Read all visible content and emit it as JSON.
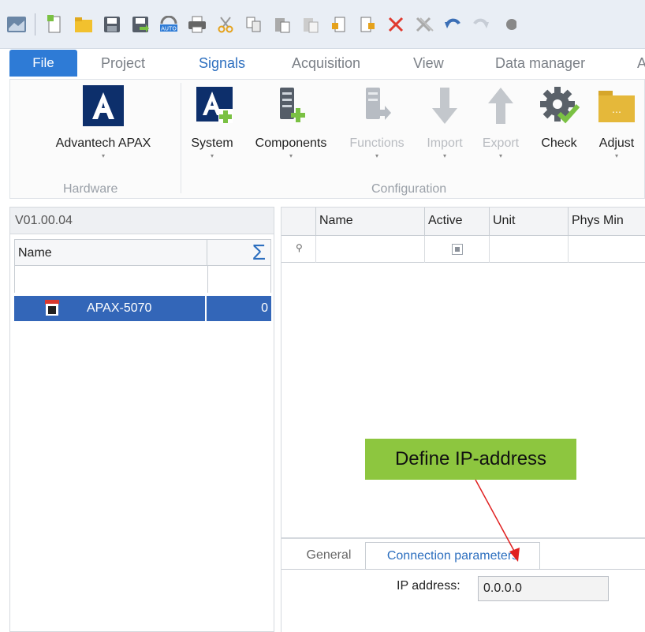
{
  "quick_access": {
    "icons": [
      "app-menu-icon",
      "new-icon",
      "open-icon",
      "save-icon",
      "save-as-icon",
      "auto-icon",
      "print-icon",
      "cut-icon",
      "copy-icon",
      "paste-icon",
      "paste-special-icon",
      "import-file-icon",
      "export-file-icon",
      "delete-icon",
      "delete-all-icon",
      "undo-icon",
      "redo-icon"
    ],
    "auto_label": "AUTO"
  },
  "ribbon_tabs": [
    "File",
    "Project",
    "Signals",
    "Acquisition",
    "View",
    "Data manager",
    "A"
  ],
  "ribbon": {
    "hardware_group": {
      "label": "Hardware",
      "buttons": [
        {
          "label": "Advantech APAX"
        }
      ]
    },
    "configuration_group": {
      "label": "Configuration",
      "buttons": [
        {
          "label": "System",
          "enabled": true
        },
        {
          "label": "Components",
          "enabled": true
        },
        {
          "label": "Functions",
          "enabled": false
        },
        {
          "label": "Import",
          "enabled": false
        },
        {
          "label": "Export",
          "enabled": false
        },
        {
          "label": "Check",
          "enabled": true
        },
        {
          "label": "Adjust",
          "enabled": true
        }
      ]
    }
  },
  "left_panel": {
    "version": "V01.00.04",
    "columns": [
      "Name",
      "Σ"
    ],
    "rows": [
      {
        "name": "APAX-5070",
        "count": "0"
      }
    ]
  },
  "signal_grid": {
    "columns": [
      "Name",
      "Active",
      "Unit",
      "Phys Min"
    ]
  },
  "callout": {
    "text": "Define IP-address"
  },
  "bottom_tabs": {
    "tabs": [
      "General",
      "Connection parameters"
    ],
    "active": "Connection parameters",
    "ip_label": "IP address:",
    "ip_value": "0.0.0.0"
  },
  "colors": {
    "file_tab": "#2e7bd6",
    "selection": "#3366b8",
    "callout": "#8dc63f",
    "arrow": "#e02020",
    "accent_text": "#2d6fbf"
  }
}
